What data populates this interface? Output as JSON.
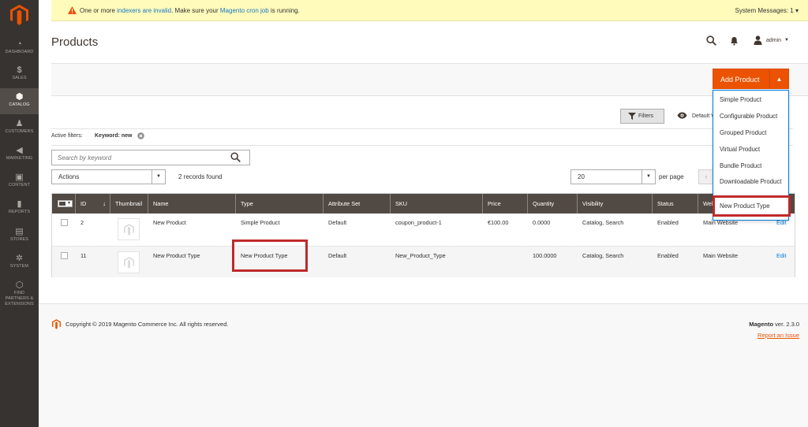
{
  "sidebar": {
    "items": [
      {
        "label": "Dashboard",
        "icon": "dashboard-icon"
      },
      {
        "label": "Sales",
        "icon": "dollar-icon"
      },
      {
        "label": "Catalog",
        "icon": "cube-icon"
      },
      {
        "label": "Customers",
        "icon": "customers-icon"
      },
      {
        "label": "Marketing",
        "icon": "megaphone-icon"
      },
      {
        "label": "Content",
        "icon": "content-icon"
      },
      {
        "label": "Reports",
        "icon": "bar-chart-icon"
      },
      {
        "label": "Stores",
        "icon": "store-icon"
      },
      {
        "label": "System",
        "icon": "gear-icon"
      },
      {
        "label_line1": "Find",
        "label_line2": "Partners &",
        "label_line3": "Extensions",
        "icon": "puzzle-icon"
      }
    ],
    "active": "Catalog"
  },
  "system_message": {
    "pre": "One or more ",
    "link1": "indexers are invalid",
    "mid": ". Make sure your ",
    "link2": "Magento cron job",
    "post": " is running.",
    "counter": "System Messages: 1"
  },
  "header": {
    "title": "Products",
    "user": "admin"
  },
  "add_product": {
    "label": "Add Product",
    "menu": [
      "Simple Product",
      "Configurable Product",
      "Grouped Product",
      "Virtual Product",
      "Bundle Product",
      "Downloadable Product",
      "New Product Type"
    ]
  },
  "toolbar": {
    "filters_label": "Filters",
    "default_view": "Default View",
    "active_filters_label": "Active filters:",
    "active_filter_name": "Keyword:",
    "active_filter_value": "new",
    "search_placeholder": "Search by keyword",
    "actions_label": "Actions",
    "records_found": "2 records found",
    "per_page_value": "20",
    "per_page_label": "per page"
  },
  "table": {
    "columns": [
      "ID",
      "Thumbnail",
      "Name",
      "Type",
      "Attribute Set",
      "SKU",
      "Price",
      "Quantity",
      "Visibility",
      "Status",
      "Websites",
      "Action"
    ],
    "rows": [
      {
        "id": "2",
        "name": "New Product",
        "type": "Simple Product",
        "attribute_set": "Default",
        "sku": "coupon_product-1",
        "price": "€100.00",
        "quantity": "0.0000",
        "visibility": "Catalog, Search",
        "status": "Enabled",
        "websites": "Main Website",
        "action": "Edit"
      },
      {
        "id": "11",
        "name": "New Product Type",
        "type": "New Product Type",
        "attribute_set": "Default",
        "sku": "New_Product_Type",
        "price": "",
        "quantity": "100.0000",
        "visibility": "Catalog, Search",
        "status": "Enabled",
        "websites": "Main Website",
        "action": "Edit"
      }
    ]
  },
  "footer": {
    "copyright": "Copyright © 2019 Magento Commerce Inc. All rights reserved.",
    "brand": "Magento",
    "version": " ver. 2.3.0",
    "report_issue": "Report an Issue"
  },
  "colors": {
    "sidebar_bg": "#373330",
    "accent_orange": "#eb5202",
    "table_header": "#514943",
    "highlight_red": "#c0292c",
    "message_bg": "#fffbbb"
  }
}
